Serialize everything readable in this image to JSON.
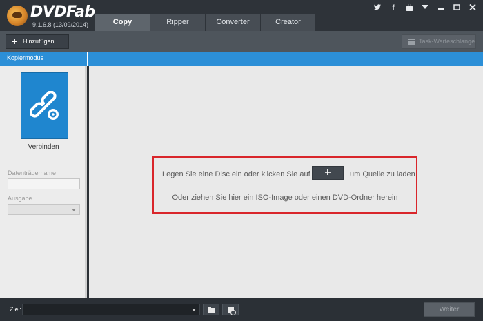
{
  "app": {
    "brand": "DVDFab",
    "version": "9.1.6.8 (13/09/2014)"
  },
  "tabs": [
    {
      "label": "Copy",
      "active": true
    },
    {
      "label": "Ripper",
      "active": false
    },
    {
      "label": "Converter",
      "active": false
    },
    {
      "label": "Creator",
      "active": false
    }
  ],
  "window_controls": {
    "twitter_icon": "twitter-icon",
    "facebook_icon": "facebook-icon",
    "youtube_icon": "youtube-icon",
    "menu_icon": "dropdown-menu-icon",
    "minimize_icon": "minimize-icon",
    "maximize_icon": "maximize-icon",
    "close_icon": "close-icon"
  },
  "toolbar": {
    "add_label": "Hinzufügen",
    "task_queue_label": "Task-Warteschlange"
  },
  "mode_bar": {
    "label": "Kopiermodus"
  },
  "sidebar": {
    "mode_label": "Verbinden",
    "volume_label": "Datenträgername",
    "volume_value": "",
    "output_label": "Ausgabe",
    "output_value": ""
  },
  "main": {
    "instruction_part1": "Legen Sie eine Disc ein oder klicken Sie auf",
    "instruction_part2": "um Quelle zu laden",
    "instruction_line2": "Oder ziehen Sie hier ein ISO-Image oder einen DVD-Ordner herein"
  },
  "bottom": {
    "target_label": "Ziel:",
    "target_value": "",
    "next_label": "Weiter"
  },
  "colors": {
    "accent_blue": "#2c8fd7",
    "highlight_red": "#d9262b",
    "dark_chrome": "#2e3339"
  }
}
